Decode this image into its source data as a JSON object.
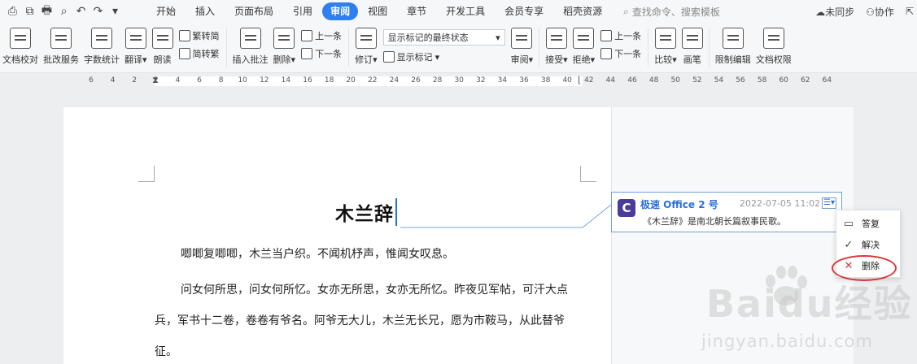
{
  "menubar": {
    "quick_icons": [
      "⎙",
      "⧉",
      "🖶",
      "⌕",
      "↶",
      "↷",
      "▾"
    ],
    "tabs": [
      "开始",
      "插入",
      "页面布局",
      "引用",
      "审阅",
      "视图",
      "章节",
      "开发工具",
      "会员专享",
      "稻壳资源"
    ],
    "active_tab": "审阅",
    "search_placeholder": "查找命令、搜索模板",
    "sync": "未同步",
    "collab": "协作"
  },
  "ribbon": {
    "doc_proof": "文档校对",
    "batch_service": "批改服务",
    "word_count": "字数统计",
    "translate": "翻译",
    "read_aloud": "朗读",
    "to_traditional": "繁转简",
    "to_simplified": "简转繁",
    "insert_comment": "插入批注",
    "delete": "删除",
    "prev1": "上一条",
    "next1": "下一条",
    "revise": "修订",
    "markup_select": "显示标记的最终状态",
    "show_markup": "显示标记",
    "review": "审阅",
    "accept": "接受",
    "reject": "拒绝",
    "prev2": "上一条",
    "next2": "下一条",
    "compare": "比较",
    "pen": "画笔",
    "restrict_edit": "限制编辑",
    "doc_permission": "文档权限"
  },
  "ruler": {
    "ticks": [
      "6",
      "4",
      "2",
      "2",
      "4",
      "6",
      "8",
      "10",
      "12",
      "14",
      "16",
      "18",
      "20",
      "22",
      "24",
      "26",
      "28",
      "30",
      "32",
      "34",
      "36",
      "38",
      "40",
      "42",
      "44",
      "46",
      "48",
      "50",
      "52",
      "54",
      "56",
      "58",
      "60",
      "62",
      "64"
    ]
  },
  "document": {
    "title": "木兰辞",
    "para1": "唧唧复唧唧，木兰当户织。不闻机杼声，惟闻女叹息。",
    "para2": "问女何所思，问女何所忆。女亦无所思，女亦无所忆。昨夜见军帖，可汗大点兵，军书十二卷，卷卷有爷名。阿爷无大儿，木兰无长兄，愿为市鞍马，从此替爷征。"
  },
  "comment": {
    "avatar_letter": "C",
    "author": "极速 Office 2 号",
    "date": "2022-07-05 11:02",
    "text": "《木兰辞》是南北朝长篇叙事民歌。"
  },
  "context_menu": {
    "reply": "答复",
    "resolve": "解决",
    "delete": "删除"
  },
  "watermark": {
    "brand": "Baidu经验",
    "url": "jingyan.baidu.com"
  },
  "colors": {
    "accent": "#2e7ff0",
    "highlight_oval": "#d63a3a",
    "avatar": "#4b3b9a"
  }
}
